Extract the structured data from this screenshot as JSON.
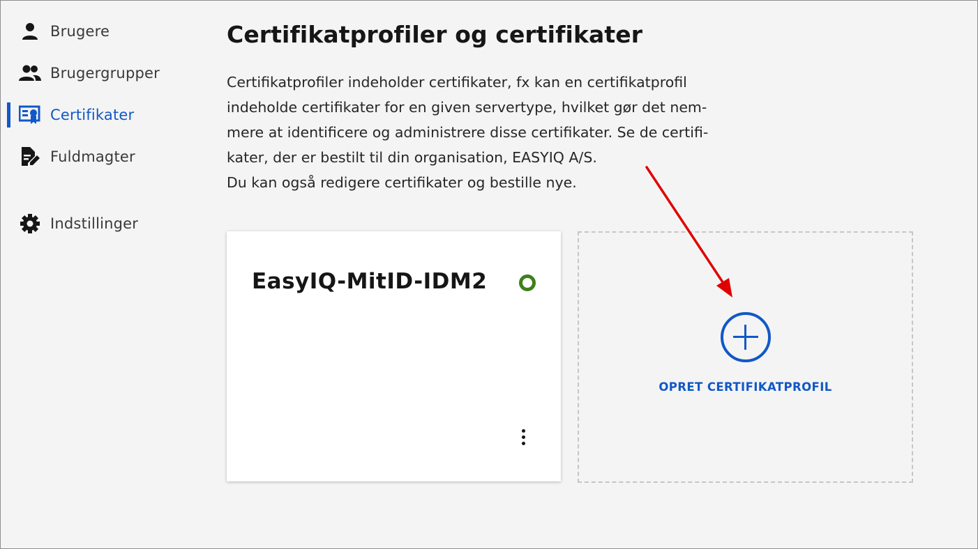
{
  "sidebar": {
    "items": [
      {
        "label": "Brugere",
        "icon": "user-icon",
        "active": false
      },
      {
        "label": "Brugergrupper",
        "icon": "user-group-icon",
        "active": false
      },
      {
        "label": "Certifikater",
        "icon": "certificate-icon",
        "active": true
      },
      {
        "label": "Fuldmagter",
        "icon": "document-edit-icon",
        "active": false
      },
      {
        "label": "Indstillinger",
        "icon": "gear-icon",
        "active": false
      }
    ]
  },
  "main": {
    "title": "Certifikatprofiler og certifikater",
    "description_lines": [
      "Certifikatprofiler indeholder certifikater, fx kan en certifikatprofil",
      "indeholde certifikater for en given servertype, hvilket gør det nem-",
      "mere at identificere og administrere disse certifikater. Se de certifi-",
      "kater, der er bestilt til din organisation, EASYIQ A/S.",
      "Du kan også redigere certifikater og bestille nye."
    ],
    "profile_card": {
      "name": "EasyIQ-MitID-IDM2",
      "status_color": "#3f7f1a"
    },
    "create_tile": {
      "label": "OPRET CERTIFIKATPROFIL"
    }
  },
  "colors": {
    "accent": "#1158c7",
    "annotation_arrow": "#e00000"
  }
}
